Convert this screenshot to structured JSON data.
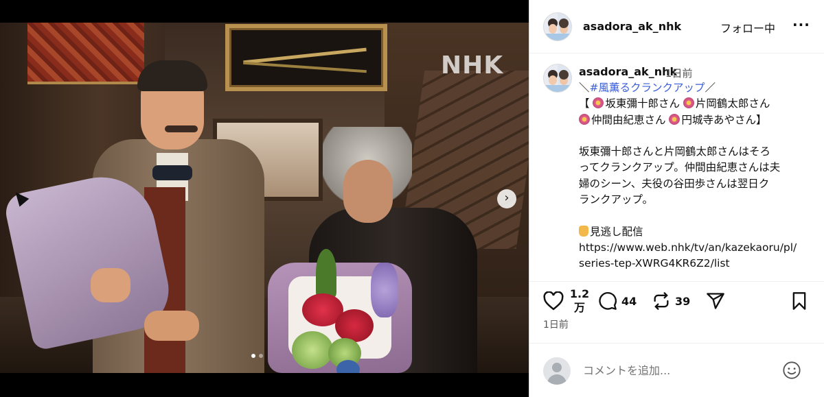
{
  "media": {
    "watermark": "NHK",
    "carousel_dots": 2,
    "carousel_active": 1
  },
  "header": {
    "username": "asadora_ak_nhk",
    "follow_label": "フォロー中",
    "more_icon": "more-horizontal-icon"
  },
  "caption": {
    "username": "asadora_ak_nhk",
    "time": "1日前",
    "lines": [
      {
        "pre": "＼",
        "tag": "#風薫るクランクアップ",
        "post": "／"
      },
      {
        "text": "【 坂東彌十郎さん 片岡鶴太郎さん"
      },
      {
        "text": "仲間由紀恵さん 円城寺あやさん】"
      },
      {
        "text": ""
      },
      {
        "text": "坂東彌十郎さんと片岡鶴太郎さんはそろ"
      },
      {
        "text": "ってクランクアップ。仲間由紀恵さんは夫"
      },
      {
        "text": "婦のシーン、夫役の谷田歩さんは翌日ク"
      },
      {
        "text": "ランクアップ。"
      },
      {
        "text": ""
      },
      {
        "text": "見逃し配信"
      },
      {
        "text": "https://www.web.nhk/tv/an/kazekaoru/pl/"
      },
      {
        "text": "series-tep-XWRG4KR6Z2/list"
      }
    ]
  },
  "actions": {
    "likes_line1": "1.2",
    "likes_line2": "万",
    "comments": "44",
    "reposts": "39",
    "date": "1日前"
  },
  "comment_box": {
    "placeholder": "コメントを追加..."
  },
  "colors": {
    "hashtag": "#3b5ed8",
    "border": "#efefef"
  }
}
